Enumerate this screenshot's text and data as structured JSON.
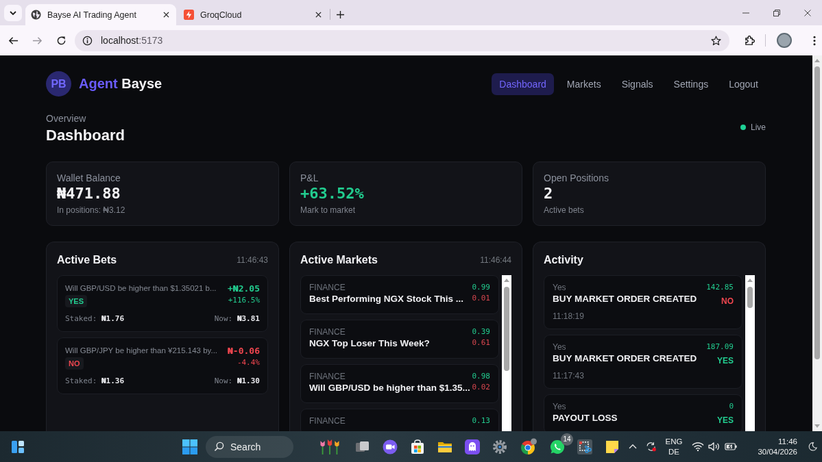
{
  "browser": {
    "tabs": [
      {
        "title": "Bayse AI Trading Agent",
        "selected": true
      },
      {
        "title": "GroqCloud",
        "selected": false
      }
    ],
    "address": {
      "host": "localhost",
      "port": ":5173"
    }
  },
  "header": {
    "logo_initials": "PB",
    "brand_accent": "Agent",
    "brand_rest": "Bayse",
    "nav": [
      {
        "label": "Dashboard",
        "selected": true
      },
      {
        "label": "Markets",
        "selected": false
      },
      {
        "label": "Signals",
        "selected": false
      },
      {
        "label": "Settings",
        "selected": false
      },
      {
        "label": "Logout",
        "selected": false
      }
    ]
  },
  "overview": {
    "eyebrow": "Overview",
    "title": "Dashboard",
    "status": {
      "label": "Live",
      "online": true
    }
  },
  "stats": [
    {
      "label": "Wallet Balance",
      "value": "₦471.88",
      "caption": "In positions: ₦3.12",
      "positive": false
    },
    {
      "label": "P&L",
      "value": "+63.52%",
      "caption": "Mark to market",
      "positive": true
    },
    {
      "label": "Open Positions",
      "value": "2",
      "caption": "Active bets",
      "positive": false
    }
  ],
  "active_bets": {
    "title": "Active Bets",
    "time": "11:46:43",
    "bets": [
      {
        "question": "Will GBP/USD be higher than $1.35021 b...",
        "side": {
          "label": "YES",
          "kind": "yes"
        },
        "pnl": "+₦2.05",
        "pnl_percent": "+116.5%",
        "gain": true,
        "staked_label": "Staked:",
        "staked": "₦1.76",
        "now_label": "Now:",
        "now": "₦3.81"
      },
      {
        "question": "Will GBP/JPY be higher than ¥215.143 by...",
        "side": {
          "label": "NO",
          "kind": "no"
        },
        "pnl": "₦-0.06",
        "pnl_percent": "-4.4%",
        "gain": false,
        "staked_label": "Staked:",
        "staked": "₦1.36",
        "now_label": "Now:",
        "now": "₦1.30"
      }
    ]
  },
  "active_markets": {
    "title": "Active Markets",
    "time": "11:46:44",
    "markets": [
      {
        "category": "FINANCE",
        "question": "Best Performing NGX Stock This ...",
        "yes_price": "0.99",
        "no_price": "0.01"
      },
      {
        "category": "FINANCE",
        "question": "NGX Top Loser This Week?",
        "yes_price": "0.39",
        "no_price": "0.61"
      },
      {
        "category": "FINANCE",
        "question": "Will GBP/USD be higher than $1.35...",
        "yes_price": "0.98",
        "no_price": "0.02"
      },
      {
        "category": "FINANCE",
        "yes_price": "0.13"
      }
    ]
  },
  "activity": {
    "title": "Activity",
    "events": [
      {
        "outcome": "Yes",
        "event": "BUY MARKET ORDER CREATED",
        "time": "11:18:19",
        "amount": "142.85",
        "side": {
          "label": "NO",
          "kind": "no"
        }
      },
      {
        "outcome": "Yes",
        "event": "BUY MARKET ORDER CREATED",
        "time": "11:17:43",
        "amount": "187.09",
        "side": {
          "label": "YES",
          "kind": "yes"
        }
      },
      {
        "outcome": "Yes",
        "event": "PAYOUT LOSS",
        "amount": "0",
        "side": {
          "label": "YES",
          "kind": "yes"
        }
      }
    ]
  },
  "taskbar": {
    "search_label": "Search",
    "app_badge": "14",
    "language": [
      "ENG",
      "DE"
    ],
    "clock": {
      "time": "11:46",
      "date": "30/04/2026"
    }
  }
}
